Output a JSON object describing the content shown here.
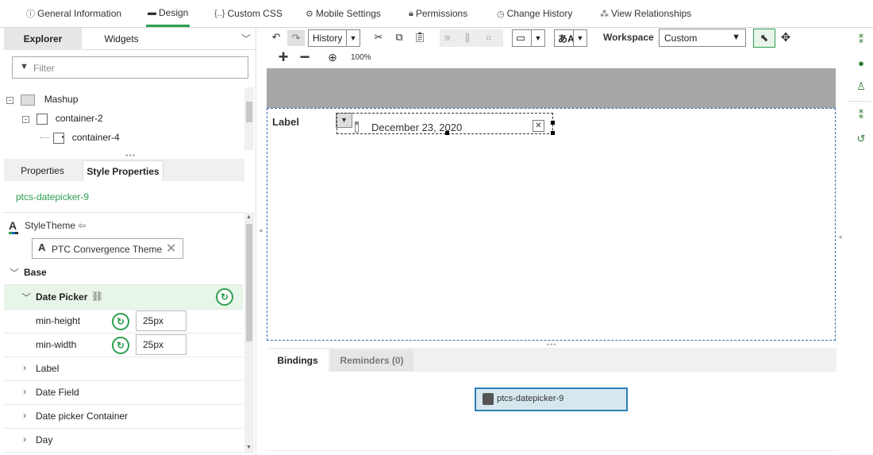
{
  "top_tabs": [
    {
      "label": "General Information",
      "icon": "info-icon"
    },
    {
      "label": "Design",
      "icon": "design-icon"
    },
    {
      "label": "Custom CSS",
      "icon": "css-icon"
    },
    {
      "label": "Mobile Settings",
      "icon": "gear-icon"
    },
    {
      "label": "Permissions",
      "icon": "lock-icon"
    },
    {
      "label": "Change History",
      "icon": "clock-icon"
    },
    {
      "label": "View Relationships",
      "icon": "relationships-icon"
    }
  ],
  "left_panel": {
    "tabs": {
      "explorer": "Explorer",
      "widgets": "Widgets"
    },
    "filter_placeholder": "Filter",
    "tree": [
      {
        "label": "Mashup"
      },
      {
        "label": "container-2"
      },
      {
        "label": "container-4"
      }
    ],
    "prop_tabs": {
      "properties": "Properties",
      "style": "Style Properties"
    },
    "selected_widget": "ptcs-datepicker-9",
    "style_theme_label": "StyleTheme",
    "style_theme_value": "PTC Convergence Theme",
    "base_section": "Base",
    "date_picker_section": "Date Picker",
    "props": [
      {
        "name": "min-height",
        "value": "25px"
      },
      {
        "name": "min-width",
        "value": "25px"
      }
    ],
    "subsections": [
      "Label",
      "Date Field",
      "Date picker Container",
      "Day"
    ]
  },
  "toolbar": {
    "history": "History",
    "workspace_label": "Workspace",
    "workspace_value": "Custom",
    "zoom": "100%"
  },
  "canvas": {
    "label_text": "Label",
    "date_value": "December 23, 2020"
  },
  "bottom": {
    "tabs": {
      "bindings": "Bindings",
      "reminders": "Reminders (0)"
    },
    "binding_node": "ptcs-datepicker-9"
  },
  "colors": {
    "accent": "#2e9e4f",
    "selected_row": "#e8f5e9",
    "canvas_header": "#a6a6a6",
    "node_bg": "#d6e8ee"
  }
}
